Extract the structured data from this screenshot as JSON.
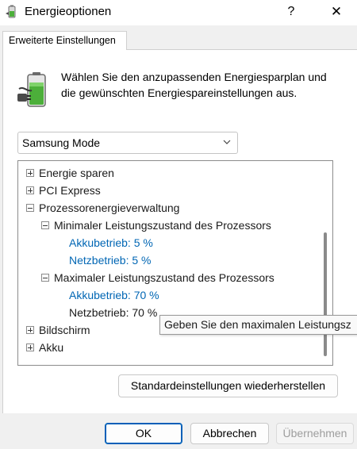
{
  "window": {
    "title": "Energieoptionen",
    "help_label": "?",
    "close_label": "✕"
  },
  "tab": {
    "label": "Erweiterte Einstellungen"
  },
  "description": {
    "line1": "Wählen Sie den anzupassenden Energiesparplan und",
    "line2": "die gewünschten Energiespareinstellungen aus."
  },
  "plan_select": {
    "value": "Samsung Mode"
  },
  "tree": {
    "items": [
      {
        "label": "Energie sparen",
        "state": "collapsed"
      },
      {
        "label": "PCI Express",
        "state": "collapsed"
      },
      {
        "label": "Prozessorenergieverwaltung",
        "state": "expanded"
      },
      {
        "label": "Minimaler Leistungszustand des Prozessors",
        "state": "expanded"
      },
      {
        "label": "Akkubetrieb: 5 %"
      },
      {
        "label": "Netzbetrieb: 5 %"
      },
      {
        "label": "Maximaler Leistungszustand des Prozessors",
        "state": "expanded"
      },
      {
        "label": "Akkubetrieb: 70 %"
      },
      {
        "label": "Netzbetrieb: 70 %"
      },
      {
        "label": "Bildschirm",
        "state": "collapsed"
      },
      {
        "label": "Akku",
        "state": "collapsed"
      }
    ]
  },
  "tooltip": {
    "text": "Geben Sie den maximalen Leistungsz"
  },
  "buttons": {
    "restore": "Standardeinstellungen wiederherstellen",
    "ok": "OK",
    "cancel": "Abbrechen",
    "apply": "Übernehmen"
  },
  "colors": {
    "accent": "#005fb8",
    "link_blue": "#0066b4",
    "battery_green": "#4caf3a"
  },
  "icons": [
    "energy-options-app-icon",
    "battery-plug-icon",
    "chevron-down-icon",
    "plus-box-icon",
    "minus-box-icon"
  ]
}
